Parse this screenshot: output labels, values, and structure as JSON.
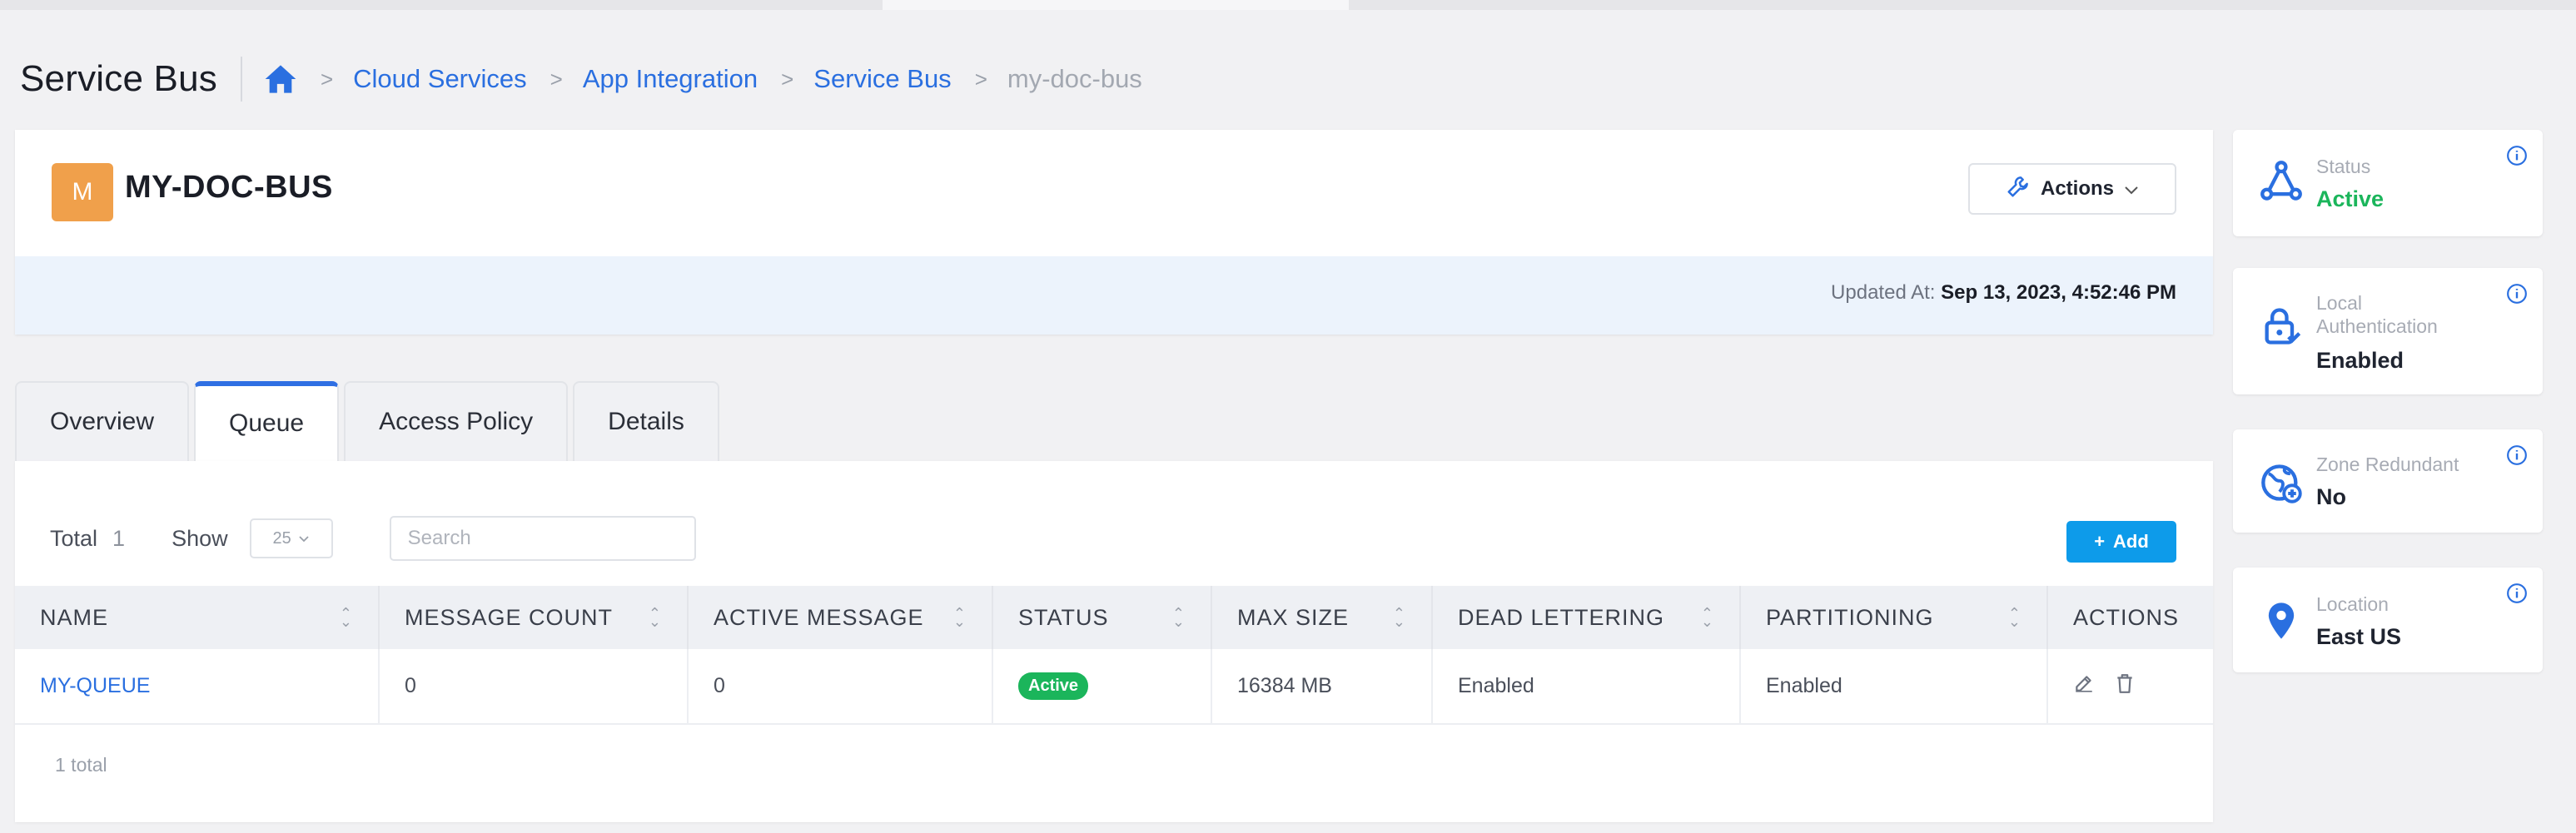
{
  "header": {
    "page_title": "Service Bus",
    "breadcrumb": [
      "Cloud Services",
      "App Integration",
      "Service Bus",
      "my-doc-bus"
    ]
  },
  "resource": {
    "avatar_letter": "M",
    "name": "MY-DOC-BUS",
    "actions_label": "Actions",
    "updated_label": "Updated At:",
    "updated_value": "Sep 13, 2023, 4:52:46 PM"
  },
  "tabs": [
    {
      "label": "Overview",
      "active": false
    },
    {
      "label": "Queue",
      "active": true
    },
    {
      "label": "Access Policy",
      "active": false
    },
    {
      "label": "Details",
      "active": false
    }
  ],
  "queue": {
    "total_label": "Total",
    "total_value": "1",
    "show_label": "Show",
    "page_size": "25",
    "search_placeholder": "Search",
    "add_label": "Add",
    "columns": [
      "NAME",
      "MESSAGE COUNT",
      "ACTIVE MESSAGE",
      "STATUS",
      "MAX SIZE",
      "DEAD LETTERING",
      "PARTITIONING",
      "ACTIONS"
    ],
    "rows": [
      {
        "name": "MY-QUEUE",
        "message_count": "0",
        "active_message": "0",
        "status": "Active",
        "max_size": "16384 MB",
        "dead_lettering": "Enabled",
        "partitioning": "Enabled"
      }
    ],
    "footer_total": "1 total"
  },
  "sidebar": {
    "status": {
      "label": "Status",
      "value": "Active"
    },
    "local_auth": {
      "label_line1": "Local",
      "label_line2": "Authentication",
      "value": "Enabled"
    },
    "zone_redundant": {
      "label": "Zone Redundant",
      "value": "No"
    },
    "location": {
      "label": "Location",
      "value": "East US"
    }
  },
  "colors": {
    "accent_blue": "#2a6fe0",
    "add_button": "#0d9bea",
    "active_green": "#1bb55b",
    "avatar_orange": "#f0a04b"
  },
  "icons": [
    "home-icon",
    "chevron-right-icon",
    "wrench-icon",
    "chevron-down-icon",
    "plus-icon",
    "sort-icon",
    "edit-icon",
    "trash-icon",
    "network-icon",
    "lock-icon",
    "globe-icon",
    "location-pin-icon",
    "info-icon"
  ]
}
